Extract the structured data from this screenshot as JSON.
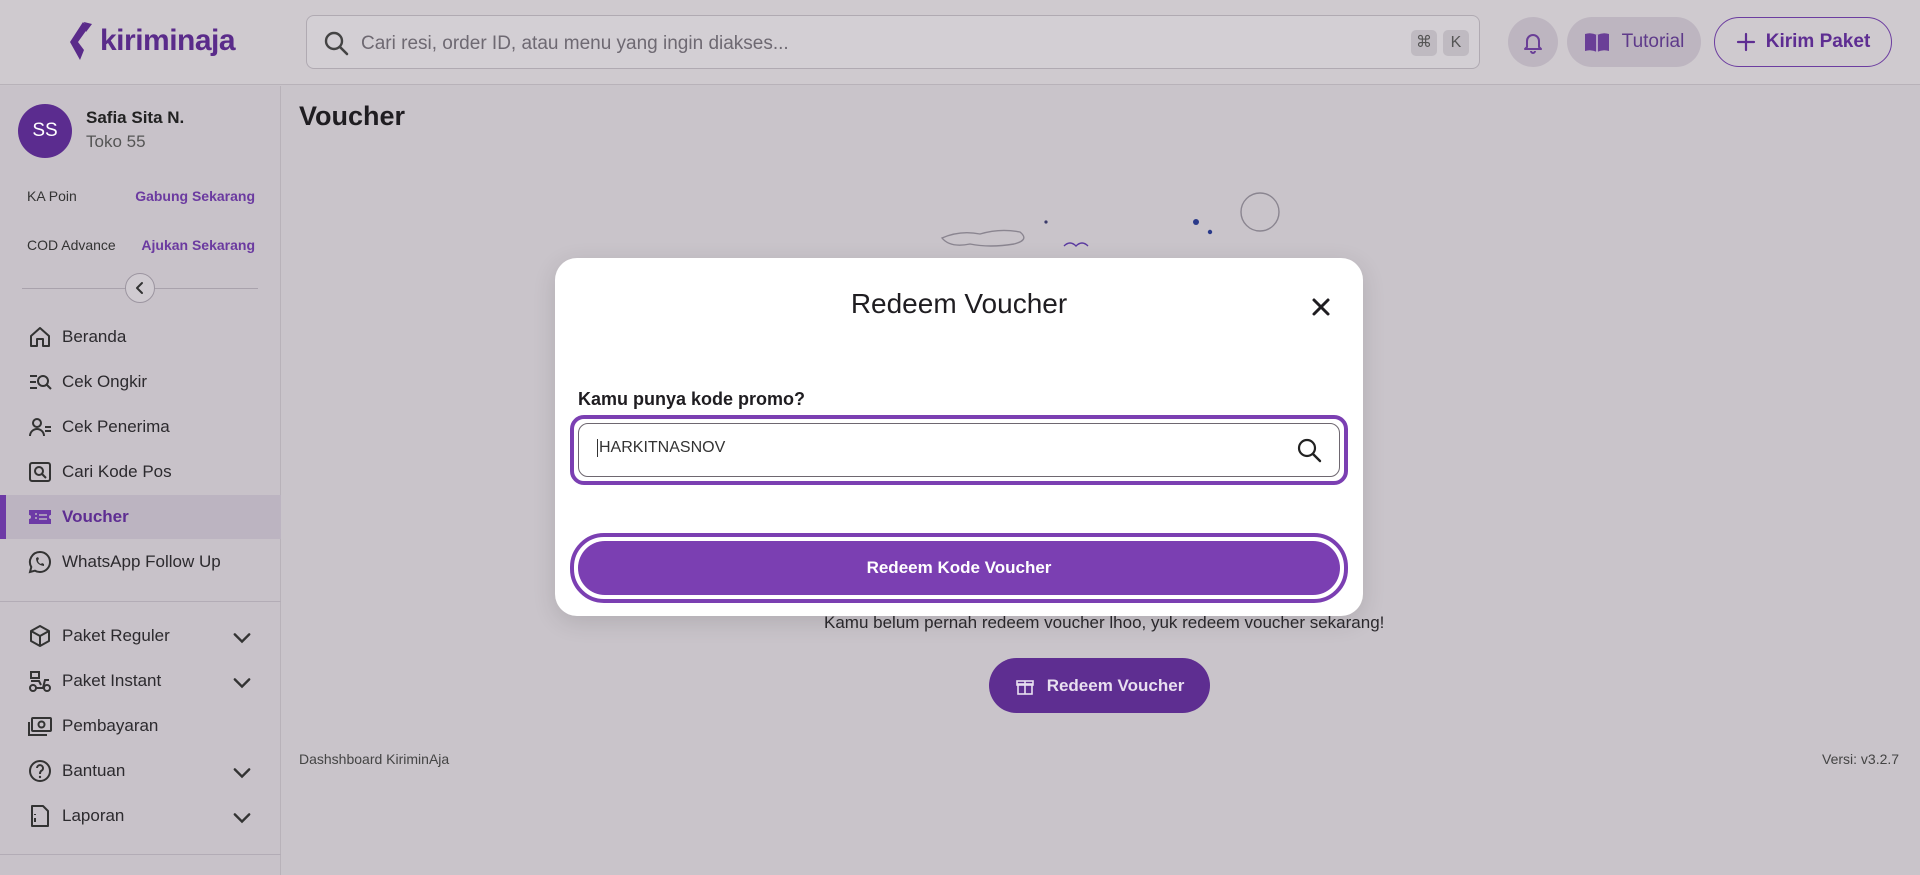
{
  "brand": {
    "name": "kiriminaja",
    "accent": "#7b3fb2"
  },
  "header": {
    "search_placeholder": "Cari resi, order ID, atau menu yang ingin diakses...",
    "shortcut_keys": [
      "⌘",
      "K"
    ],
    "tutorial_label": "Tutorial",
    "send_label": "Kirim Paket"
  },
  "user": {
    "initials": "SS",
    "name": "Safia Sita N.",
    "store": "Toko 55"
  },
  "sidebar": {
    "promos": [
      {
        "label": "KA Poin",
        "action": "Gabung Sekarang"
      },
      {
        "label": "COD Advance",
        "action": "Ajukan Sekarang"
      }
    ],
    "items": [
      {
        "label": "Beranda",
        "icon": "home-icon"
      },
      {
        "label": "Cek Ongkir",
        "icon": "list-search-icon"
      },
      {
        "label": "Cek Penerima",
        "icon": "user-check-icon"
      },
      {
        "label": "Cari Kode Pos",
        "icon": "postcode-search-icon"
      },
      {
        "label": "Voucher",
        "icon": "voucher-icon",
        "active": true
      },
      {
        "label": "WhatsApp Follow Up",
        "icon": "whatsapp-icon"
      }
    ],
    "groups": [
      {
        "label": "Paket Reguler",
        "icon": "box-icon"
      },
      {
        "label": "Paket Instant",
        "icon": "scooter-icon"
      },
      {
        "label": "Pembayaran",
        "icon": "money-icon"
      },
      {
        "label": "Bantuan",
        "icon": "help-icon"
      },
      {
        "label": "Laporan",
        "icon": "report-icon"
      }
    ]
  },
  "main": {
    "title": "Voucher",
    "empty_message": "Kamu belum pernah redeem voucher lhoo, yuk redeem voucher sekarang!",
    "redeem_button": "Redeem Voucher",
    "footer_left": "Dashshboard KiriminAja",
    "footer_right": "Versi: v3.2.7"
  },
  "modal": {
    "title": "Redeem Voucher",
    "promo_label": "Kamu punya kode promo?",
    "promo_value": "HARKITNASNOV",
    "submit_label": "Redeem Kode Voucher"
  }
}
